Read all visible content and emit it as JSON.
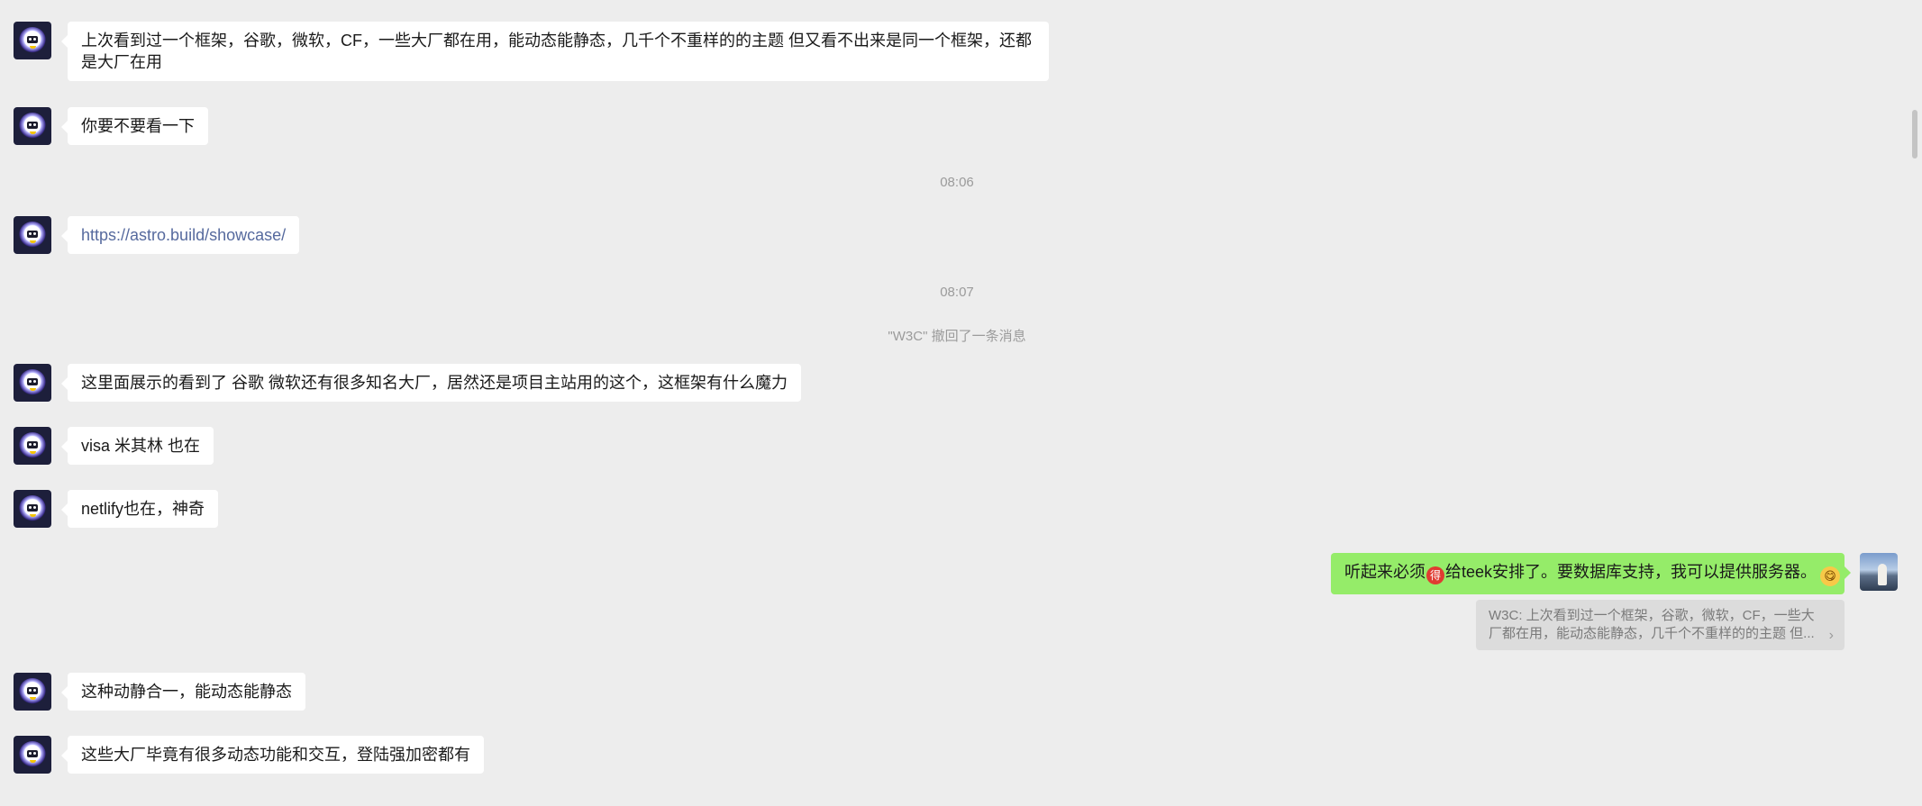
{
  "messages": [
    {
      "from": "other",
      "text": "上次看到过一个框架，谷歌，微软，CF，一些大厂都在用，能动态能静态，几千个不重样的的主题 但又看不出来是同一个框架，还都是大厂在用"
    },
    {
      "from": "other",
      "text": "你要不要看一下"
    },
    {
      "type": "time",
      "text": "08:06"
    },
    {
      "from": "other",
      "text": "https://astro.build/showcase/"
    },
    {
      "type": "time",
      "text": "08:07"
    },
    {
      "type": "system",
      "text": "\"W3C\" 撤回了一条消息"
    },
    {
      "from": "other",
      "text": "这里面展示的看到了 谷歌 微软还有很多知名大厂，居然还是项目主站用的这个，这框架有什么魔力"
    },
    {
      "from": "other",
      "text": "visa 米其林 也在"
    },
    {
      "from": "other",
      "text": "netlify也在，神奇"
    },
    {
      "from": "me",
      "text_before": "听起来必须",
      "badge": "得",
      "text_after": "给teek安排了。要数据库支持，我可以提供服务器。",
      "emoji": "😋",
      "emoji_name": "yum-face-emoji"
    },
    {
      "type": "quote",
      "text": "W3C: 上次看到过一个框架，谷歌，微软，CF，一些大厂都在用，能动态能静态，几千个不重样的的主题 但..."
    },
    {
      "from": "other",
      "text": "这种动静合一，能动态能静态"
    },
    {
      "from": "other",
      "text": "这些大厂毕竟有很多动态功能和交互，登陆强加密都有"
    }
  ],
  "colors": {
    "background": "#ededed",
    "incoming_bubble": "#ffffff",
    "outgoing_bubble": "#95ec69",
    "link": "#566a9e",
    "meta_text": "#9b9b9b"
  }
}
